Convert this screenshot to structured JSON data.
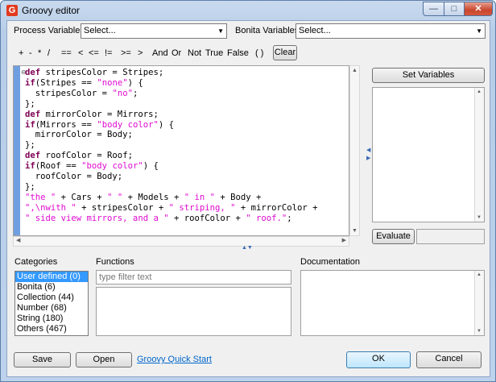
{
  "window": {
    "title": "Groovy editor",
    "icon": "groovy-icon",
    "minimize": "—",
    "maximize": "□",
    "close": "✕"
  },
  "variables": {
    "process_label": "Process Variables",
    "process_value": "Select...",
    "bonita_label": "Bonita Variables",
    "bonita_value": "Select..."
  },
  "operators": [
    "+",
    "-",
    "*",
    "/",
    "==",
    "<",
    "<=",
    "!=",
    ">=",
    ">",
    "And",
    "Or",
    "Not",
    "True",
    "False",
    "( )"
  ],
  "clear_label": "Clear",
  "editor": {
    "fold_marker": "⊖",
    "lines": [
      [
        [
          "kw",
          "def"
        ],
        [
          "t",
          " stripesColor = Stripes;"
        ]
      ],
      [
        [
          "kw",
          "if"
        ],
        [
          "t",
          "(Stripes == "
        ],
        [
          "str",
          "\"none\""
        ],
        [
          "t",
          ") {"
        ]
      ],
      [
        [
          "t",
          "  stripesColor = "
        ],
        [
          "str",
          "\"no\""
        ],
        [
          "t",
          ";"
        ]
      ],
      [
        [
          "t",
          "};"
        ]
      ],
      [
        [
          "kw",
          "def"
        ],
        [
          "t",
          " mirrorColor = Mirrors;"
        ]
      ],
      [
        [
          "kw",
          "if"
        ],
        [
          "t",
          "(Mirrors == "
        ],
        [
          "str",
          "\"body color\""
        ],
        [
          "t",
          ") {"
        ]
      ],
      [
        [
          "t",
          "  mirrorColor = Body;"
        ]
      ],
      [
        [
          "t",
          "};"
        ]
      ],
      [
        [
          "kw",
          "def"
        ],
        [
          "t",
          " roofColor = Roof;"
        ]
      ],
      [
        [
          "kw",
          "if"
        ],
        [
          "t",
          "(Roof == "
        ],
        [
          "str",
          "\"body color\""
        ],
        [
          "t",
          ") {"
        ]
      ],
      [
        [
          "t",
          "  roofColor = Body;"
        ]
      ],
      [
        [
          "t",
          "};"
        ]
      ],
      [
        [
          "str",
          "\"the \""
        ],
        [
          "t",
          " + Cars + "
        ],
        [
          "str",
          "\" \""
        ],
        [
          "t",
          " + Models + "
        ],
        [
          "str",
          "\" in \""
        ],
        [
          "t",
          " + Body +"
        ]
      ],
      [
        [
          "str",
          "\",\\nwith \""
        ],
        [
          "t",
          " + stripesColor + "
        ],
        [
          "str",
          "\" striping, \""
        ],
        [
          "t",
          " + mirrorColor +"
        ]
      ],
      [
        [
          "str",
          "\" side view mirrors, and a \""
        ],
        [
          "t",
          " + roofColor + "
        ],
        [
          "str",
          "\" roof.\""
        ],
        [
          "t",
          ";"
        ]
      ]
    ]
  },
  "right_panel": {
    "set_variables_label": "Set Variables",
    "evaluate_label": "Evaluate"
  },
  "bottom": {
    "categories_label": "Categories",
    "categories": [
      "User defined (0)",
      "Bonita (6)",
      "Collection (44)",
      "Number (68)",
      "String (180)",
      "Others (467)"
    ],
    "selected_category": 0,
    "functions_label": "Functions",
    "filter_placeholder": "type filter text",
    "documentation_label": "Documentation"
  },
  "footer": {
    "save_label": "Save",
    "open_label": "Open",
    "quick_start_label": "Groovy Quick Start",
    "ok_label": "OK",
    "cancel_label": "Cancel"
  }
}
